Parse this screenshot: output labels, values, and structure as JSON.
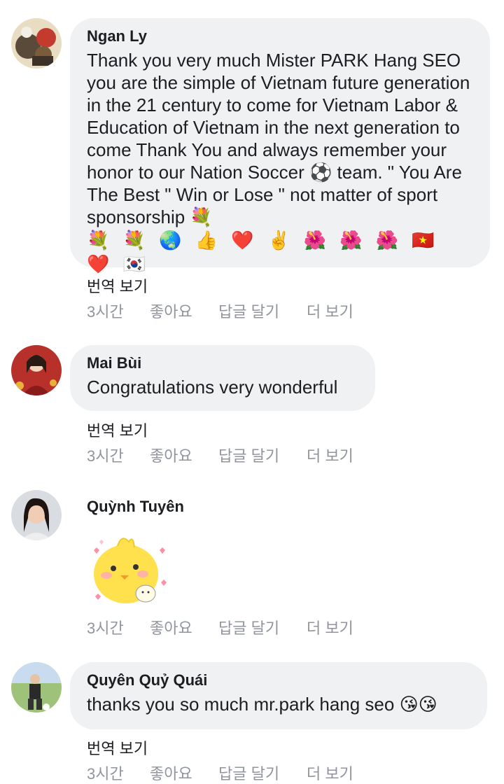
{
  "comments": [
    {
      "author": "Ngan Ly",
      "text": "Thank you very much Mister PARK Hang SEO you are the simple of Vietnam future generation in the 21 century to come for Vietnam Labor & Education of Vietnam in the next generation to come Thank You and always remember your honor to our Nation Soccer ⚽ team. \" You Are The Best \" Win or Lose \" not matter of sport sponsorship 💐",
      "emoji_line": "💐 💐 🌏 👍 ❤️ ✌️ 🌺 🌺 🌺 🇻🇳 ❤️ 🇰🇷",
      "translate": "번역 보기",
      "time": "3시간",
      "like": "좋아요",
      "reply": "답글 달기",
      "more": "더 보기"
    },
    {
      "author": "Mai Bùi",
      "text": "Congratulations very wonderful",
      "translate": "번역 보기",
      "time": "3시간",
      "like": "좋아요",
      "reply": "답글 달기",
      "more": "더 보기"
    },
    {
      "author": "Quỳnh Tuyên",
      "sticker": "yellow-chick-sticker",
      "time": "3시간",
      "like": "좋아요",
      "reply": "답글 달기",
      "more": "더 보기"
    },
    {
      "author": "Quyên Quỷ Quái",
      "text": "thanks you so much mr.park hang seo 😘😘",
      "translate": "번역 보기",
      "time": "3시간",
      "like": "좋아요",
      "reply": "답글 달기",
      "more": "더 보기"
    }
  ],
  "colors": {
    "bubble": "#eff1f3",
    "text": "#1c1e21",
    "meta": "#90949c"
  }
}
